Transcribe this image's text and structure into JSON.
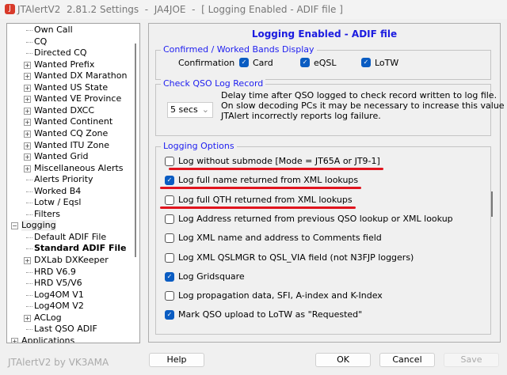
{
  "window": {
    "title": "JTAlertV2  2.81.2 Settings  -  JA4JOE  -  [ Logging Enabled - ADIF file ]"
  },
  "tree": [
    {
      "label": "Own Call",
      "level": 1,
      "exp": ""
    },
    {
      "label": "CQ",
      "level": 1,
      "exp": ""
    },
    {
      "label": "Directed CQ",
      "level": 1,
      "exp": ""
    },
    {
      "label": "Wanted Prefix",
      "level": 1,
      "exp": "+"
    },
    {
      "label": "Wanted DX Marathon",
      "level": 1,
      "exp": "+"
    },
    {
      "label": "Wanted US State",
      "level": 1,
      "exp": "+"
    },
    {
      "label": "Wanted VE Province",
      "level": 1,
      "exp": "+"
    },
    {
      "label": "Wanted DXCC",
      "level": 1,
      "exp": "+"
    },
    {
      "label": "Wanted Continent",
      "level": 1,
      "exp": "+"
    },
    {
      "label": "Wanted CQ Zone",
      "level": 1,
      "exp": "+"
    },
    {
      "label": "Wanted ITU Zone",
      "level": 1,
      "exp": "+"
    },
    {
      "label": "Wanted Grid",
      "level": 1,
      "exp": "+"
    },
    {
      "label": "Miscellaneous Alerts",
      "level": 1,
      "exp": "+"
    },
    {
      "label": "Alerts Priority",
      "level": 1,
      "exp": ""
    },
    {
      "label": "Worked B4",
      "level": 1,
      "exp": ""
    },
    {
      "label": "Lotw / Eqsl",
      "level": 1,
      "exp": ""
    },
    {
      "label": "Filters",
      "level": 1,
      "exp": ""
    },
    {
      "label": "Logging",
      "level": 0,
      "exp": "-"
    },
    {
      "label": "Default ADIF File",
      "level": 1,
      "exp": ""
    },
    {
      "label": "Standard ADIF File",
      "level": 1,
      "exp": "",
      "selected": true
    },
    {
      "label": "DXLab DXKeeper",
      "level": 1,
      "exp": "+"
    },
    {
      "label": "HRD V6.9",
      "level": 1,
      "exp": ""
    },
    {
      "label": "HRD V5/V6",
      "level": 1,
      "exp": ""
    },
    {
      "label": "Log4OM V1",
      "level": 1,
      "exp": ""
    },
    {
      "label": "Log4OM V2",
      "level": 1,
      "exp": ""
    },
    {
      "label": "ACLog",
      "level": 1,
      "exp": "+"
    },
    {
      "label": "Last QSO ADIF",
      "level": 1,
      "exp": ""
    },
    {
      "label": "Applications",
      "level": 0,
      "exp": "+"
    }
  ],
  "panel": {
    "title": "Logging Enabled - ADIF file",
    "bands": {
      "legend": "Confirmed / Worked Bands Display",
      "label": "Confirmation",
      "options": [
        {
          "label": "Card",
          "checked": true
        },
        {
          "label": "eQSL",
          "checked": true
        },
        {
          "label": "LoTW",
          "checked": true
        }
      ]
    },
    "check": {
      "legend": "Check QSO Log Record",
      "select_value": "5 secs",
      "desc": [
        "Delay time after QSO logged to check record written to log file.",
        "On slow decoding PCs it may be necessary to increase this value if",
        "JTAlert incorrectly reports log failure."
      ]
    },
    "logging": {
      "legend": "Logging Options",
      "options": [
        {
          "label": "Log without submode [Mode = JT65A or JT9-1]",
          "checked": false,
          "underlined": true
        },
        {
          "label": "Log full name returned from XML lookups",
          "checked": true,
          "underlined": true
        },
        {
          "label": "Log full QTH returned from XML lookups",
          "checked": false,
          "underlined": true
        },
        {
          "label": "Log Address returned from previous QSO lookup or XML lookup",
          "checked": false
        },
        {
          "label": "Log XML name and address to Comments field",
          "checked": false
        },
        {
          "label": "Log XML QSLMGR to QSL_VIA field (not N3FJP loggers)",
          "checked": false
        },
        {
          "label": "Log Gridsquare",
          "checked": true
        },
        {
          "label": "Log propagation data, SFI, A-index and K-Index",
          "checked": false
        },
        {
          "label": "Mark QSO upload to LoTW as \"Requested\"",
          "checked": true
        }
      ]
    }
  },
  "footer": {
    "brand": "JTAlertV2 by VK3AMA",
    "help": "Help",
    "ok": "OK",
    "cancel": "Cancel",
    "save": "Save"
  },
  "colors": {
    "accent": "#0a5cc2",
    "legend": "#2020f0",
    "highlight": "#e0141e"
  }
}
